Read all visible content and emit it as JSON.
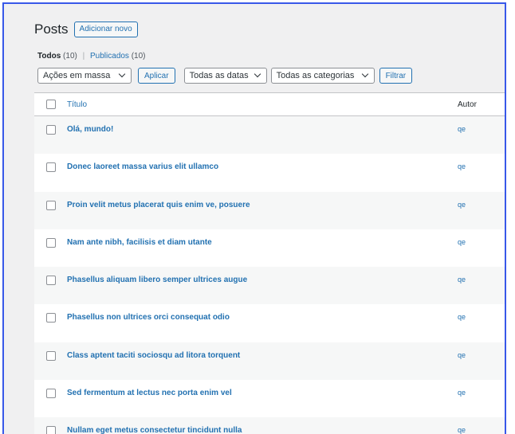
{
  "header": {
    "title": "Posts",
    "add_new_label": "Adicionar novo"
  },
  "views": {
    "all_label": "Todos",
    "all_count": "(10)",
    "separator": "|",
    "published_label": "Publicados",
    "published_count": "(10)"
  },
  "tablenav": {
    "bulk_actions": "Ações em massa",
    "apply_label": "Aplicar",
    "dates_filter": "Todas as datas",
    "categories_filter": "Todas as categorias",
    "filter_label": "Filtrar"
  },
  "table": {
    "columns": {
      "title": "Título",
      "author": "Autor"
    },
    "rows": [
      {
        "title": "Olá, mundo!",
        "author": "qe"
      },
      {
        "title": "Donec laoreet massa varius elit ullamco",
        "author": "qe"
      },
      {
        "title": "Proin velit metus placerat quis enim ve, posuere",
        "author": "qe"
      },
      {
        "title": "Nam ante nibh, facilisis et diam utante",
        "author": "qe"
      },
      {
        "title": "Phasellus aliquam libero semper ultrices augue",
        "author": "qe"
      },
      {
        "title": "Phasellus non ultrices orci consequat odio",
        "author": "qe"
      },
      {
        "title": "Class aptent taciti sociosqu ad litora torquent",
        "author": "qe"
      },
      {
        "title": "Sed fermentum at lectus nec porta enim vel",
        "author": "qe"
      },
      {
        "title": "Nullam eget metus consectetur tincidunt nulla",
        "author": "qe"
      }
    ]
  },
  "colors": {
    "accent": "#2271b1",
    "frame_border": "#3858e9",
    "background": "#f0f0f1"
  }
}
